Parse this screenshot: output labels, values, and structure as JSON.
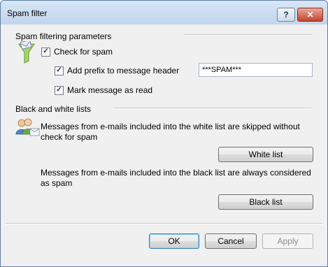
{
  "window": {
    "title": "Spam filter",
    "help_label": "?",
    "close_label": "✕"
  },
  "spam_params": {
    "heading": "Spam filtering parameters",
    "check_for_spam": {
      "label": "Check for spam",
      "checked": true
    },
    "add_prefix": {
      "label": "Add prefix to message header",
      "checked": true,
      "value": "***SPAM***"
    },
    "mark_read": {
      "label": "Mark message as read",
      "checked": true
    }
  },
  "lists": {
    "heading": "Black and white lists",
    "white_text": "Messages from e-mails included into the white list are skipped without check for spam",
    "white_button": "White list",
    "black_text": "Messages from e-mails included into the black list are always considered as spam",
    "black_button": "Black list"
  },
  "footer": {
    "ok": "OK",
    "cancel": "Cancel",
    "apply": "Apply"
  },
  "icons": {
    "funnel": "filter-funnel-icon",
    "users": "users-icon"
  }
}
